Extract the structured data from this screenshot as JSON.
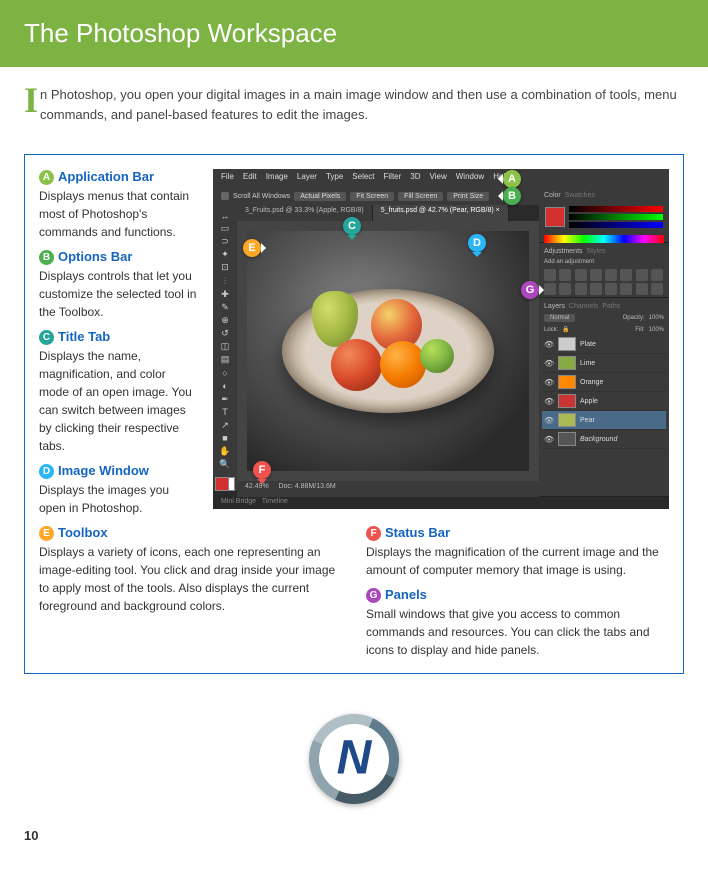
{
  "header": {
    "title": "The Photoshop Workspace"
  },
  "intro": {
    "dropcap": "I",
    "text": "n Photoshop, you open your digital images in a main image window and then use a combination of tools, menu commands, and panel-based features to edit the images."
  },
  "sections": {
    "a": {
      "letter": "A",
      "title": "Application Bar",
      "desc": "Displays menus that contain most of Photoshop's commands and functions."
    },
    "b": {
      "letter": "B",
      "title": "Options Bar",
      "desc": "Displays controls that let you customize the selected tool in the Toolbox."
    },
    "c": {
      "letter": "C",
      "title": "Title Tab",
      "desc": "Displays the name, magnification, and color mode of an open image. You can switch between images by clicking their respective tabs."
    },
    "d": {
      "letter": "D",
      "title": "Image Window",
      "desc": "Displays the images you open in Photoshop."
    },
    "e": {
      "letter": "E",
      "title": "Toolbox",
      "desc": "Displays a variety of icons, each one representing an image-editing tool. You click and drag inside your image to apply most of the tools. Also displays the current foreground and background colors."
    },
    "f": {
      "letter": "F",
      "title": "Status Bar",
      "desc": "Displays the magnification of the current image and the amount of computer memory that image is using."
    },
    "g": {
      "letter": "G",
      "title": "Panels",
      "desc": "Small windows that give you access to common commands and resources. You can click the tabs and icons to display and hide panels."
    }
  },
  "ps": {
    "menus": [
      "File",
      "Edit",
      "Image",
      "Layer",
      "Type",
      "Select",
      "Filter",
      "3D",
      "View",
      "Window",
      "Help"
    ],
    "optbar": {
      "scroll": "Scroll All Windows",
      "actual": "Actual Pixels",
      "fit": "Fit Screen",
      "fill": "Fill Screen",
      "print": "Print Size"
    },
    "tabs": [
      {
        "label": "3_Fruits.psd @ 33.3% (Apple, RGB/8)"
      },
      {
        "label": "5_fruits.psd @ 42.7% (Pear, RGB/8) ×"
      }
    ],
    "status": {
      "zoom": "42.49%",
      "doc": "Doc: 4.88M/13.6M"
    },
    "bottombar": {
      "mb": "Mini Bridge",
      "tl": "Timeline"
    },
    "panels": {
      "color": "Color",
      "swatches": "Swatches",
      "adjustments": "Adjustments",
      "styles": "Styles",
      "addadj": "Add an adjustment",
      "layers": "Layers",
      "channels": "Channels",
      "paths": "Paths",
      "normal": "Normal",
      "opacity": "Opacity:",
      "opv": "100%",
      "lock": "Lock:",
      "fill": "Fill:",
      "fillv": "100%",
      "layerlist": [
        "Plate",
        "Lime",
        "Orange",
        "Apple",
        "Pear",
        "Background"
      ]
    }
  },
  "page_number": "10"
}
